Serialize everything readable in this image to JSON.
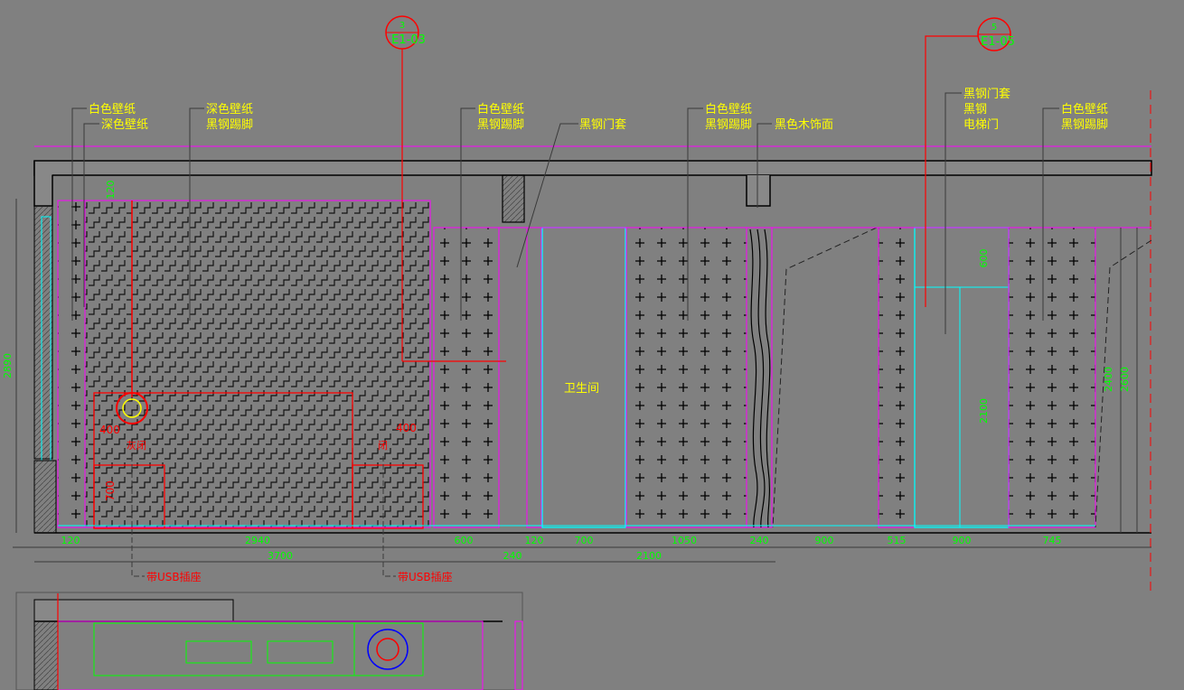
{
  "colors": {
    "background": "#808080",
    "yellow": "#ffff00",
    "green": "#00ff00",
    "red": "#ff0000",
    "magenta": "#ff00ff",
    "cyan": "#00ffff",
    "black": "#000000",
    "blue": "#0000ff",
    "leader": "#3a3a3a"
  },
  "callouts": {
    "c1_l1": "白色壁纸",
    "c1_l2": "深色壁纸",
    "c2_l1": "深色壁纸",
    "c2_l2": "黑钢踢脚",
    "c3_l1": "白色壁纸",
    "c3_l2": "黑钢踢脚",
    "c4": "黑钢门套",
    "c5_l1": "白色壁纸",
    "c5_l2": "黑钢踢脚",
    "c5_l3": "黑色木饰面",
    "c6_l1": "黑钢门套",
    "c6_l2": "黑钢",
    "c6_l3": "电梯门",
    "c7_l1": "白色壁纸",
    "c7_l2": "黑钢踢脚"
  },
  "section_marks": {
    "mark1_top": "3",
    "mark1_bottom": "E1-03",
    "mark2_top": "5",
    "mark2_bottom": "E1-05"
  },
  "room_label": "卫生间",
  "usb_label": "带USB插座",
  "red_labels": {
    "left_400": "400",
    "right_400": "400",
    "height_700": "700",
    "tag_left": "灰闭",
    "tag_right": "闭"
  },
  "dims_bottom": {
    "d1": "120",
    "d2": "2940",
    "d3": "600",
    "d4": "120",
    "d5": "700",
    "d6": "1050",
    "d7": "240",
    "d8": "900",
    "d9": "515",
    "d10": "900",
    "d11": "745"
  },
  "dims_total": {
    "t1": "3700",
    "t2": "240",
    "t3": "2100"
  },
  "dims_vertical": {
    "left_total": "2890",
    "door_top": "600",
    "door_height": "2100",
    "right_a": "2400",
    "right_b": "2600",
    "small": "120"
  }
}
